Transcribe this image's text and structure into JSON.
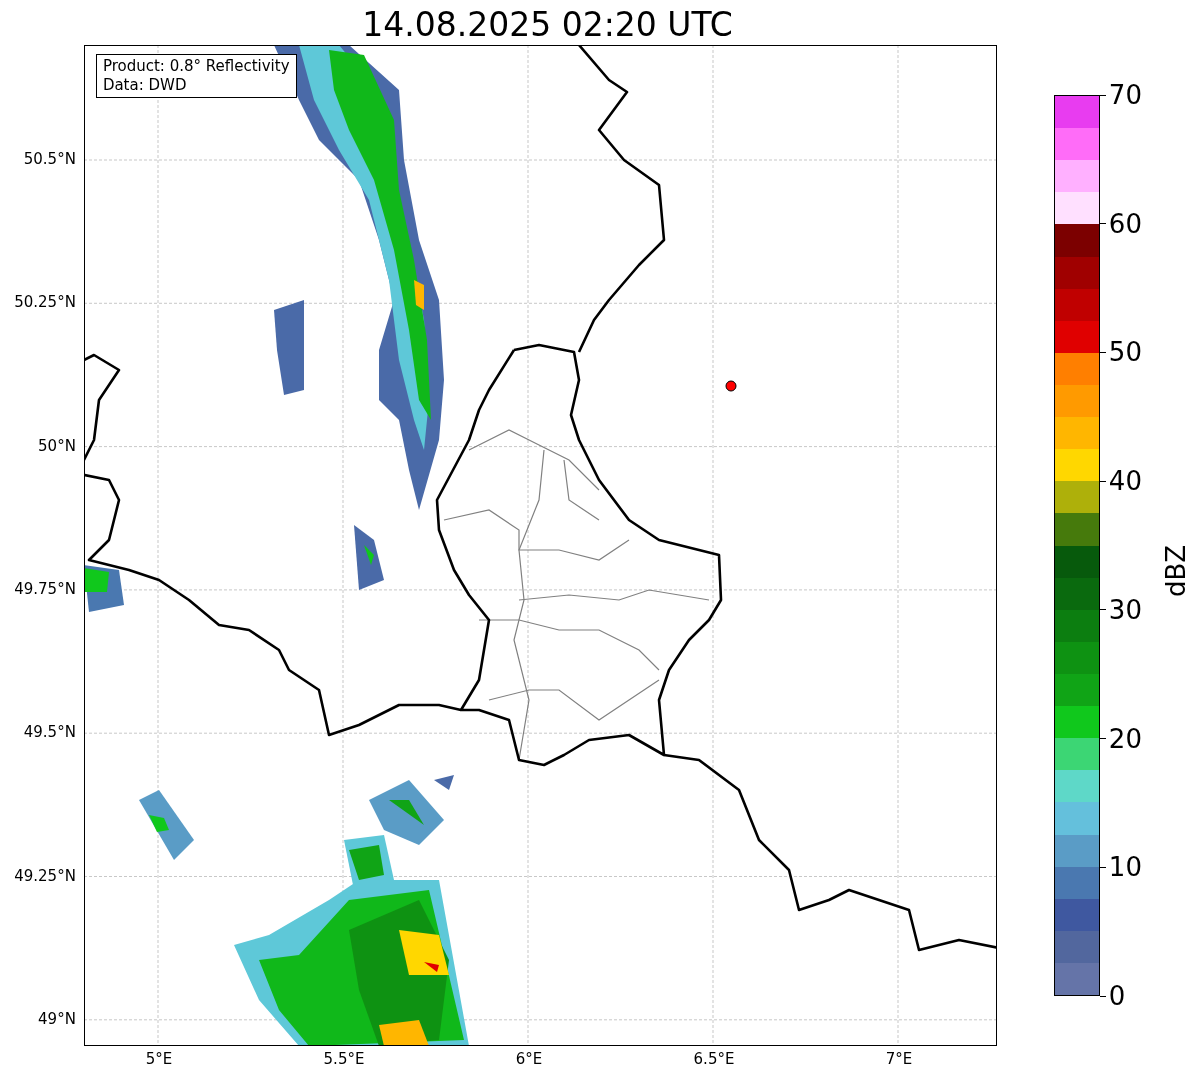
{
  "title": "14.08.2025 02:20 UTC",
  "legend": {
    "lines": [
      "Product: 0.8° Reflectivity",
      "Data: DWD"
    ]
  },
  "y_ticks": [
    "50.5°N",
    "50.25°N",
    "50°N",
    "49.75°N",
    "49.5°N",
    "49.25°N",
    "49°N"
  ],
  "x_ticks": [
    "5°E",
    "5.5°E",
    "6°E",
    "6.5°E",
    "7°E"
  ],
  "colorbar": {
    "label": "dBZ",
    "ticks": [
      "70",
      "60",
      "50",
      "40",
      "30",
      "20",
      "10",
      "0"
    ],
    "bins": [
      {
        "color": "#e83cf0"
      },
      {
        "color": "#ff6cf8"
      },
      {
        "color": "#ffb0ff"
      },
      {
        "color": "#ffe0ff"
      },
      {
        "color": "#7c0000"
      },
      {
        "color": "#a00000"
      },
      {
        "color": "#c00000"
      },
      {
        "color": "#e00000"
      },
      {
        "color": "#ff7f00"
      },
      {
        "color": "#ff9a00"
      },
      {
        "color": "#ffb600"
      },
      {
        "color": "#ffd700"
      },
      {
        "color": "#aeb00a"
      },
      {
        "color": "#467a0c"
      },
      {
        "color": "#075a0c"
      },
      {
        "color": "#0a6a0e"
      },
      {
        "color": "#0c7e10"
      },
      {
        "color": "#0e9212"
      },
      {
        "color": "#10a416"
      },
      {
        "color": "#10c81c"
      },
      {
        "color": "#3cd674"
      },
      {
        "color": "#5ed8c8"
      },
      {
        "color": "#64c0dc"
      },
      {
        "color": "#5a9cc6"
      },
      {
        "color": "#4a78b0"
      },
      {
        "color": "#3f58a0"
      },
      {
        "color": "#52679e"
      },
      {
        "color": "#6574a8"
      }
    ]
  }
}
